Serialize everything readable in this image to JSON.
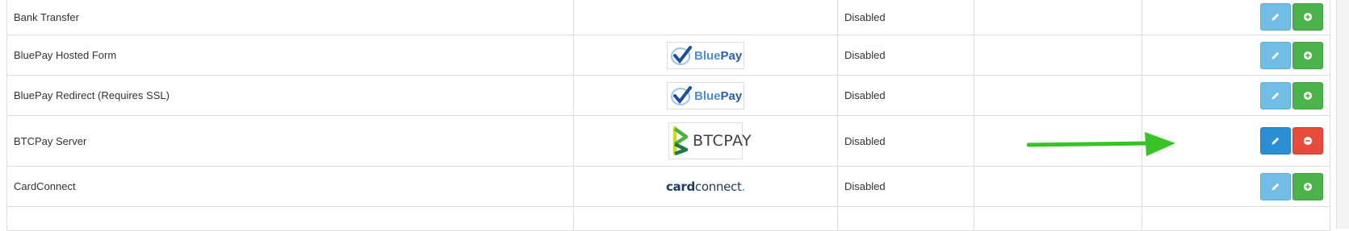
{
  "rows": [
    {
      "name": "Bank Transfer",
      "logo": "none",
      "status": "Disabled",
      "edit_style": "light",
      "action": "install"
    },
    {
      "name": "BluePay Hosted Form",
      "logo": "bluepay",
      "status": "Disabled",
      "edit_style": "light",
      "action": "install"
    },
    {
      "name": "BluePay Redirect (Requires SSL)",
      "logo": "bluepay",
      "status": "Disabled",
      "edit_style": "light",
      "action": "install"
    },
    {
      "name": "BTCPay Server",
      "logo": "btcpay",
      "status": "Disabled",
      "edit_style": "dark",
      "action": "uninstall"
    },
    {
      "name": "CardConnect",
      "logo": "cardconnect",
      "status": "Disabled",
      "edit_style": "light",
      "action": "install"
    }
  ],
  "logos": {
    "bluepay": {
      "part1": "Blue",
      "part2": "Pay"
    },
    "btcpay": {
      "text": "BTCPAY"
    },
    "cardconnect": {
      "part1": "card",
      "part2": "connect",
      "dot": "."
    }
  },
  "icons": {
    "edit": "pencil-icon",
    "install": "plus-circle-icon",
    "uninstall": "minus-circle-icon"
  },
  "colors": {
    "edit_light": "#71bde5",
    "edit_dark": "#2a8fd3",
    "install": "#4cb24a",
    "uninstall": "#e64b3c",
    "arrow": "#38c427"
  }
}
